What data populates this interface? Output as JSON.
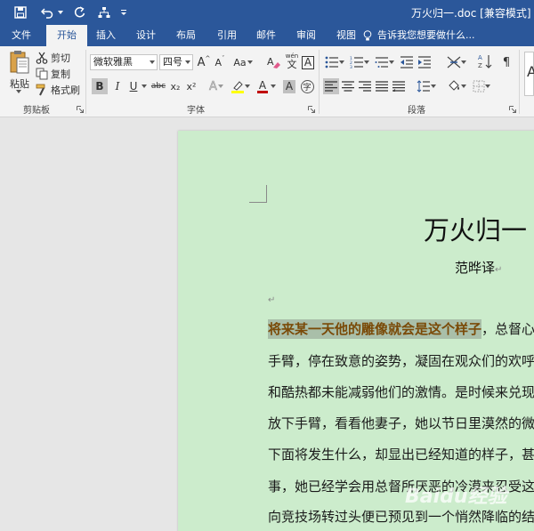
{
  "window": {
    "title": "万火归一.doc [兼容模式] - We"
  },
  "quick_access": [
    {
      "name": "save-icon"
    },
    {
      "name": "undo-icon"
    },
    {
      "name": "redo-icon"
    },
    {
      "name": "tree-icon"
    },
    {
      "name": "customize-icon"
    }
  ],
  "tabs": [
    {
      "label": "文件",
      "active": false
    },
    {
      "label": "开始",
      "active": true
    },
    {
      "label": "插入",
      "active": false
    },
    {
      "label": "设计",
      "active": false
    },
    {
      "label": "布局",
      "active": false
    },
    {
      "label": "引用",
      "active": false
    },
    {
      "label": "邮件",
      "active": false
    },
    {
      "label": "审阅",
      "active": false
    },
    {
      "label": "视图",
      "active": false
    }
  ],
  "tell_me": "告诉我您想要做什么...",
  "ribbon": {
    "clipboard": {
      "label": "剪贴板",
      "paste": "粘贴",
      "cut": "剪切",
      "copy": "复制",
      "format_painter": "格式刷"
    },
    "font": {
      "label": "字体",
      "font_name": "微软雅黑",
      "font_size": "四号",
      "bold": "B",
      "italic": "I",
      "underline": "U",
      "strike": "abc",
      "subscript": "x₂",
      "superscript": "x²",
      "grow": "A",
      "shrink": "A",
      "case": "Aa",
      "phonetic": "wén",
      "phonetic_base": "文",
      "border_char": "A",
      "effects": "A",
      "font_color": "A",
      "shading": "A",
      "enclose": "字"
    },
    "paragraph": {
      "label": "段落"
    },
    "colors": {
      "highlight": "#ffff00",
      "font_color": "#c00000"
    }
  },
  "document": {
    "heading": "万火归一",
    "author": "范晔译",
    "pilcrow": "↵",
    "lines": [
      {
        "highlight": "将来某一天他的雕像就会是这个样子",
        "text": "，总督心"
      },
      {
        "highlight": "",
        "text": "手臂，停在致意的姿势，凝固在观众们的欢呼"
      },
      {
        "highlight": "",
        "text": "和酷热都未能减弱他们的激情。是时候来兑现"
      },
      {
        "highlight": "",
        "text": "放下手臂，看看他妻子，她以节日里漠然的微"
      },
      {
        "highlight": "",
        "text": "下面将发生什么，却显出已经知道的样子，甚"
      },
      {
        "highlight": "",
        "text": "事，她已经学会用总督所厌恶的冷漠来忍受这"
      },
      {
        "highlight": "",
        "text": "向竞技场转过头便已预见到一个悄然降临的结"
      }
    ]
  },
  "watermark": "Baidu经验"
}
